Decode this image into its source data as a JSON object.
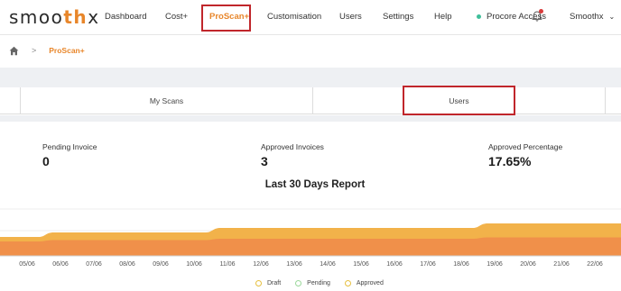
{
  "nav": {
    "logo_prefix": "smoo",
    "logo_accent": "th",
    "logo_suffix": "x",
    "items": [
      "Dashboard",
      "Cost+",
      "ProScan+",
      "Customisation",
      "Users",
      "Settings",
      "Help"
    ],
    "procore_label": "Procore Access",
    "account_label": "Smoothx",
    "accent_color": "#e8862a",
    "highlight_color": "#c0262b"
  },
  "breadcrumb": {
    "home_icon": "home-icon",
    "separator": ">",
    "current": "ProScan+"
  },
  "tabs": [
    "My Scans",
    "Users"
  ],
  "stats": [
    {
      "label": "Pending Invoice",
      "value": "0"
    },
    {
      "label": "Approved Invoices",
      "value": "3"
    },
    {
      "label": "Approved Percentage",
      "value": "17.65%"
    }
  ],
  "report": {
    "title": "Last 30 Days Report"
  },
  "chart_data": {
    "type": "area",
    "title": "Last 30 Days Report",
    "x": [
      "05/06",
      "06/06",
      "07/06",
      "08/06",
      "09/06",
      "10/06",
      "11/06",
      "12/06",
      "13/06",
      "14/06",
      "15/06",
      "16/06",
      "17/06",
      "18/06",
      "19/06",
      "20/06",
      "21/06",
      "22/06"
    ],
    "series": [
      {
        "name": "Draft",
        "values": [
          14,
          14,
          14,
          14,
          14,
          14,
          14,
          14,
          14,
          14,
          14,
          14,
          14,
          14,
          14,
          14,
          14,
          14
        ]
      },
      {
        "name": "Pending",
        "values": [
          0,
          0,
          0,
          0,
          0,
          0,
          0,
          0,
          0,
          0,
          0,
          0,
          0,
          0,
          0,
          0,
          0,
          0
        ]
      },
      {
        "name": "Approved",
        "values": [
          0,
          1,
          1,
          1,
          1,
          1,
          2,
          2,
          2,
          2,
          2,
          2,
          2,
          2,
          3,
          3,
          3,
          3
        ]
      }
    ],
    "legend_position": "bottom",
    "grid": true,
    "colors": {
      "draft": "#f08a4a",
      "approved": "#f2b24a",
      "legend_marker": "#e6c040"
    }
  }
}
